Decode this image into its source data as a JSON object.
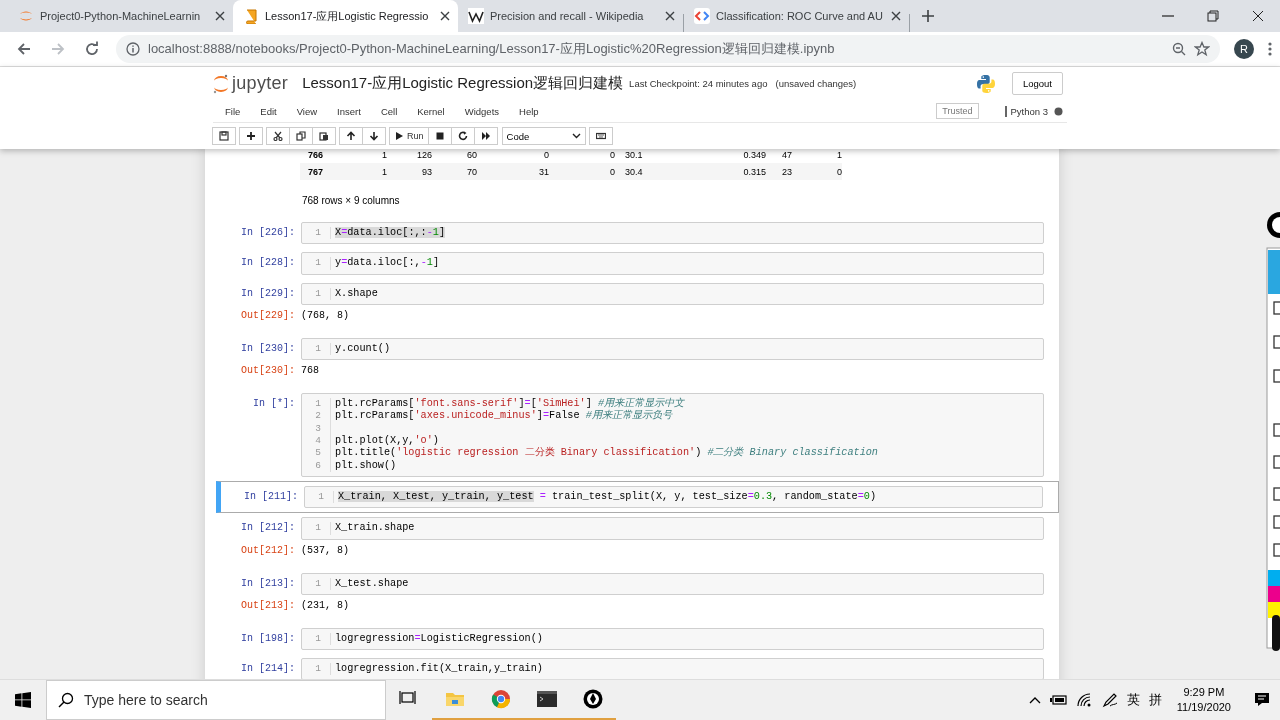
{
  "browser": {
    "tabs": [
      {
        "title": "Project0-Python-MachineLearnin",
        "kind": "jupyter",
        "selected": false
      },
      {
        "title": "Lesson17-应用Logistic Regressio",
        "kind": "book",
        "selected": true
      },
      {
        "title": "Precision and recall - Wikipedia",
        "kind": "wiki",
        "selected": false
      },
      {
        "title": "Classification: ROC Curve and AU",
        "kind": "code",
        "selected": false
      }
    ],
    "url": "localhost:8888/notebooks/Project0-Python-MachineLearning/Lesson17-应用Logistic%20Regression逻辑回归建模.ipynb",
    "profile": "R"
  },
  "notebook": {
    "logo": "jupyter",
    "title": "Lesson17-应用Logistic Regression逻辑回归建模",
    "checkpoint": "Last Checkpoint: 24 minutes ago",
    "save_status": "(unsaved changes)",
    "logout": "Logout",
    "menu": [
      "File",
      "Edit",
      "View",
      "Insert",
      "Cell",
      "Kernel",
      "Widgets",
      "Help"
    ],
    "trusted": "Trusted",
    "kernel": "Python 3",
    "run": "Run",
    "cell_type": "Code"
  },
  "table": {
    "rows": [
      [
        "766",
        "1",
        "126",
        "60",
        "0",
        "0",
        "30.1",
        "0.349",
        "47",
        "1"
      ],
      [
        "767",
        "1",
        "93",
        "70",
        "31",
        "0",
        "30.4",
        "0.315",
        "23",
        "0"
      ]
    ],
    "footer": "768 rows × 9 columns"
  },
  "cells": [
    {
      "prompt": "In [226]:",
      "selected": false,
      "lines": [
        {
          "n": "1",
          "segments": [
            {
              "text": "X=data.iloc[:,:-1]",
              "highlighted": true
            }
          ]
        }
      ]
    },
    {
      "prompt": "In [228]:",
      "selected": false,
      "lines": [
        {
          "n": "1",
          "segments": [
            {
              "text": "y=data.iloc[:,-1]",
              "highlighted": false
            }
          ]
        }
      ]
    },
    {
      "prompt": "In [229]:",
      "selected": false,
      "lines": [
        {
          "n": "1",
          "segments": [
            {
              "text": "X.shape",
              "highlighted": false
            }
          ]
        }
      ],
      "out_prompt": "Out[229]:",
      "output": "(768, 8)"
    },
    {
      "prompt": "In [230]:",
      "selected": false,
      "lines": [
        {
          "n": "1",
          "segments": [
            {
              "text": "y.count()",
              "highlighted": false
            }
          ]
        }
      ],
      "out_prompt": "Out[230]:",
      "output": "768"
    },
    {
      "prompt": "In [*]:",
      "selected": false,
      "lines": [
        {
          "n": "1",
          "segments": [
            {
              "text": "plt.rcParams['font.sans-serif']=['SimHei'] #用来正常显示中文",
              "highlighted": false
            }
          ]
        },
        {
          "n": "2",
          "segments": [
            {
              "text": "plt.rcParams['axes.unicode_minus']=False #用来正常显示负号",
              "highlighted": false
            }
          ]
        },
        {
          "n": "3"
        },
        {
          "n": "4",
          "segments": [
            {
              "text": "plt.plot(X,y,'o')",
              "highlighted": false
            }
          ]
        },
        {
          "n": "5",
          "segments": [
            {
              "text": "plt.title('logistic regression 二分类 Binary classification') #二分类 Binary classification",
              "highlighted": false
            }
          ]
        },
        {
          "n": "6",
          "segments": [
            {
              "text": "plt.show()",
              "highlighted": false
            }
          ]
        }
      ]
    },
    {
      "prompt": "In [211]:",
      "selected": true,
      "lines": [
        {
          "n": "1",
          "segments": [
            {
              "text": "X_train, X_test, y_train, y_test",
              "highlighted": true
            },
            {
              "text": " = train_test_split(X, y, test_size=0.3, random_state=0)",
              "highlighted": false
            }
          ]
        }
      ]
    },
    {
      "prompt": "In [212]:",
      "selected": false,
      "lines": [
        {
          "n": "1",
          "segments": [
            {
              "text": "X_train.shape",
              "highlighted": false
            }
          ]
        }
      ],
      "out_prompt": "Out[212]:",
      "output": "(537, 8)"
    },
    {
      "prompt": "In [213]:",
      "selected": false,
      "lines": [
        {
          "n": "1",
          "segments": [
            {
              "text": "X_test.shape",
              "highlighted": false
            }
          ]
        }
      ],
      "out_prompt": "Out[213]:",
      "output": "(231, 8)"
    },
    {
      "prompt": "In [198]:",
      "selected": false,
      "lines": [
        {
          "n": "1",
          "segments": [
            {
              "text": "logregression=LogisticRegression()",
              "highlighted": false
            }
          ]
        }
      ]
    },
    {
      "prompt": "In [214]:",
      "selected": false,
      "lines": [
        {
          "n": "1",
          "segments": [
            {
              "text": "logregression.fit(X_train,y_train)",
              "highlighted": false
            }
          ]
        }
      ]
    }
  ],
  "taskbar": {
    "search_placeholder": "Type here to search",
    "ime_language": "英",
    "ime_mode": "拼",
    "time": "9:29 PM",
    "date": "11/19/2020"
  }
}
